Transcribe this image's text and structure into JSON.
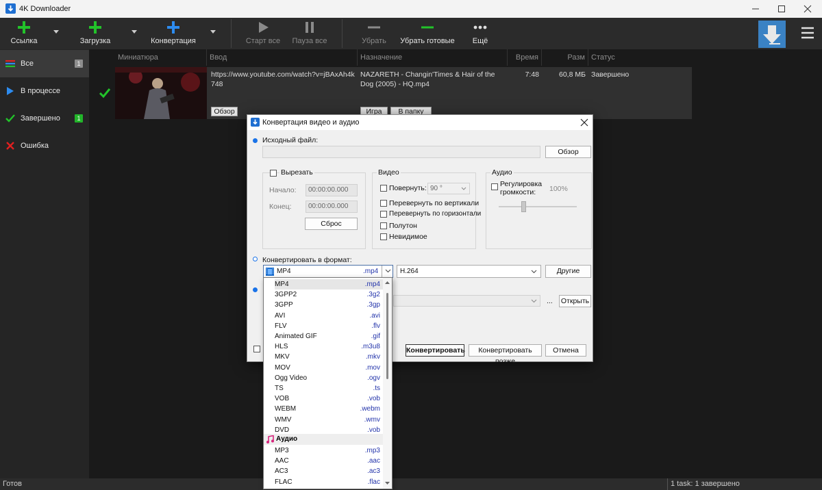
{
  "window": {
    "title": "4K Downloader"
  },
  "toolbar": {
    "link": "Ссылка",
    "download": "Загрузка",
    "convert": "Конвертация",
    "start_all": "Старт все",
    "pause_all": "Пауза все",
    "remove": "Убрать",
    "remove_done": "Убрать готовые",
    "more": "Ещё"
  },
  "sidebar": {
    "items": [
      {
        "label": "Все",
        "badge": "1"
      },
      {
        "label": "В процессе"
      },
      {
        "label": "Завершено",
        "badge": "1"
      },
      {
        "label": "Ошибка"
      }
    ]
  },
  "table": {
    "columns": [
      "Миниатюра",
      "Ввод",
      "Назначение",
      "Время",
      "Разм",
      "Статус"
    ],
    "rows": [
      {
        "input": "https://www.youtube.com/watch?v=jBAxAh4k748",
        "destination": "NAZARETH  - Changin'Times & Hair of the Dog (2005) - HQ.mp4",
        "time": "7:48",
        "size": "60,8 МБ",
        "status": "Завершено",
        "browse": "Обзор",
        "play": "Игра",
        "to_folder": "В папку"
      }
    ]
  },
  "status": {
    "left": "Готов",
    "right": "1 task: 1 завершено"
  },
  "dialog": {
    "title": "Конвертация видео и аудио",
    "source_label": "Исходный файл:",
    "source_value": "",
    "browse": "Обзор",
    "cut": {
      "title": "Вырезать",
      "start_label": "Начало:",
      "start_value": "00:00:00.000",
      "end_label": "Конец:",
      "end_value": "00:00:00.000",
      "reset": "Сброс"
    },
    "video": {
      "title": "Видео",
      "rotate": "Повернуть:",
      "rotate_value": "90 °",
      "flip_v": "Перевернуть по вертикали",
      "flip_h": "Перевернуть по горизонтали",
      "halftone": "Полутон",
      "invisible": "Невидимое"
    },
    "audio": {
      "title": "Аудио",
      "volume": "Регулировка громкости:",
      "volume_value": "100%"
    },
    "format_label": "Конвертировать в формат:",
    "format_value": "MP4",
    "format_ext": ".mp4",
    "codec_value": "H.264",
    "other": "Другие",
    "ellipsis": "...",
    "open": "Открыть",
    "convert": "Конвертировать",
    "convert_later": "Конвертировать позже",
    "cancel": "Отмена"
  },
  "dropdown": {
    "items": [
      {
        "name": "MP4",
        "ext": ".mp4"
      },
      {
        "name": "3GPP2",
        "ext": ".3g2"
      },
      {
        "name": "3GPP",
        "ext": ".3gp"
      },
      {
        "name": "AVI",
        "ext": ".avi"
      },
      {
        "name": "FLV",
        "ext": ".flv"
      },
      {
        "name": "Animated GIF",
        "ext": ".gif"
      },
      {
        "name": "HLS",
        "ext": ".m3u8"
      },
      {
        "name": "MKV",
        "ext": ".mkv"
      },
      {
        "name": "MOV",
        "ext": ".mov"
      },
      {
        "name": "Ogg Video",
        "ext": ".ogv"
      },
      {
        "name": "TS",
        "ext": ".ts"
      },
      {
        "name": "VOB",
        "ext": ".vob"
      },
      {
        "name": "WEBM",
        "ext": ".webm"
      },
      {
        "name": "WMV",
        "ext": ".wmv"
      },
      {
        "name": "DVD",
        "ext": ".vob"
      }
    ],
    "audio_header": "Аудио",
    "audio_items": [
      {
        "name": "MP3",
        "ext": ".mp3"
      },
      {
        "name": "AAC",
        "ext": ".aac"
      },
      {
        "name": "AC3",
        "ext": ".ac3"
      },
      {
        "name": "FLAC",
        "ext": ".flac"
      }
    ]
  },
  "colors": {
    "accent": "#0078d4",
    "green": "#22c32a",
    "red": "#e02020"
  }
}
